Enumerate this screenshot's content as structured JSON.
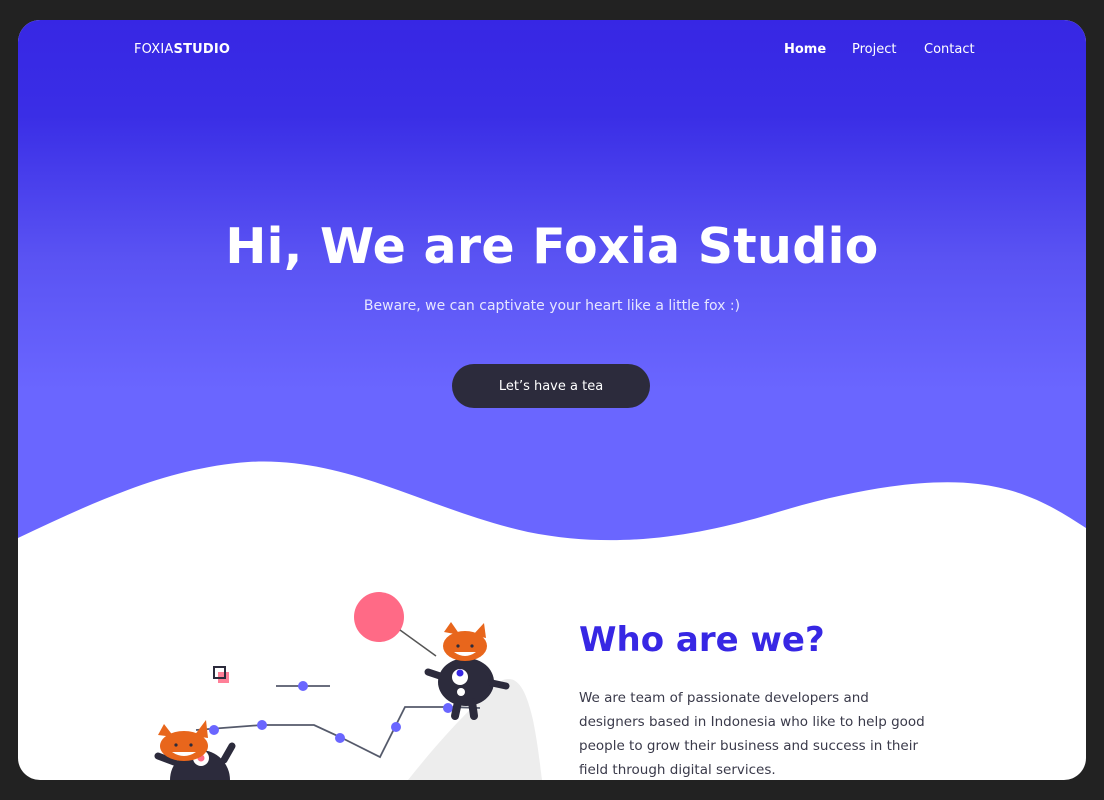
{
  "nav": {
    "logo_light": "FOXIA",
    "logo_bold": "STUDIO",
    "links": [
      {
        "label": "Home",
        "active": true
      },
      {
        "label": "Project",
        "active": false
      },
      {
        "label": "Contact",
        "active": false
      }
    ]
  },
  "hero": {
    "title": "Hi, We are Foxia Studio",
    "subtitle": "Beware, we can captivate your heart like a little fox :)",
    "cta_label": "Let’s have a tea"
  },
  "about": {
    "title": "Who are we?",
    "text": "We are team of passionate developers and designers based in Indonesia who like to help good people to grow their business and success in their field through digital services."
  },
  "colors": {
    "primary": "#3727e4",
    "hero_light": "#6a66ff",
    "dark": "#2c2b3c",
    "fox_orange": "#e8661c",
    "balloon_pink": "#ff6a86",
    "frame": "#222222"
  },
  "icons": [
    "fox-character",
    "balloon",
    "square-outline-icon"
  ]
}
